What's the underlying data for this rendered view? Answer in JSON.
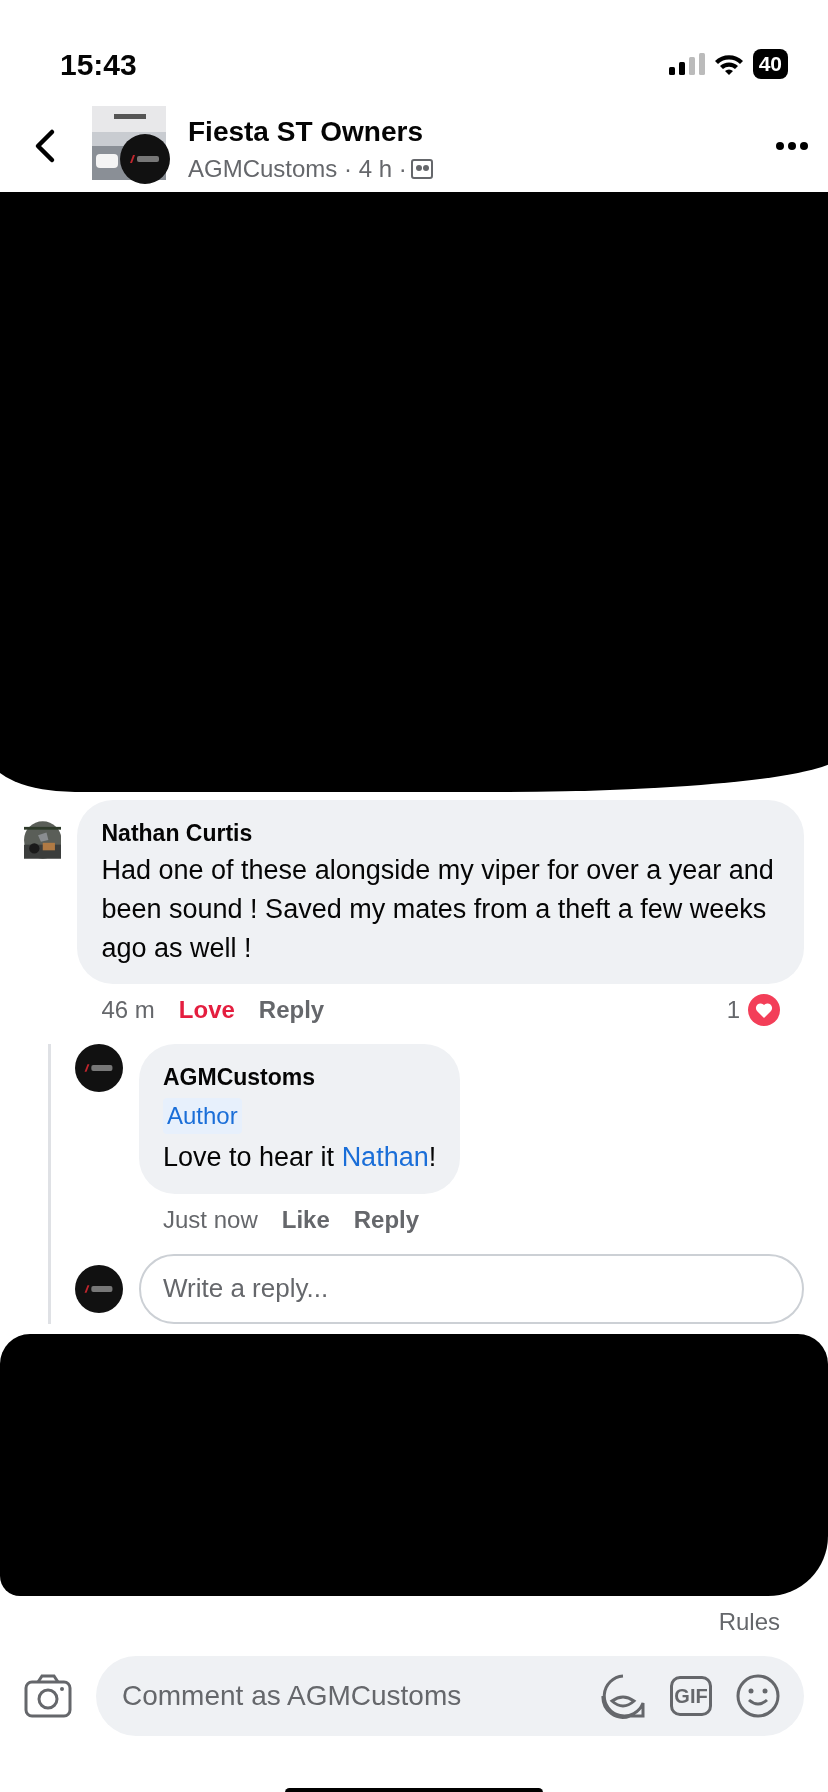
{
  "status_bar": {
    "time": "15:43",
    "battery": "40"
  },
  "header": {
    "title": "Fiesta ST Owners",
    "subtitle": "AGMCustoms · 4 h ·"
  },
  "redactions": [
    {
      "kind": "redacted"
    },
    {
      "kind": "redacted"
    }
  ],
  "comment": {
    "author": "Nathan Curtis",
    "text": "Had one of these alongside my viper for over a year and been sound ! Saved my mates from a theft a few weeks ago as well !",
    "time": "46 m",
    "reaction_button": {
      "label": "Love",
      "selected": true
    },
    "reply_button": "Reply",
    "reaction_count": "1",
    "replies": [
      {
        "author": "AGMCustoms",
        "badge": "Author",
        "text": "Love to hear it ",
        "mention": "Nathan",
        "after": "!",
        "time": "Just now",
        "reaction_button": {
          "label": "Like",
          "selected": false
        },
        "reply_button": "Reply"
      }
    ],
    "reply_field": {
      "placeholder": "Write a reply..."
    }
  },
  "rules_link": "Rules",
  "composer": {
    "placeholder": "Comment as AGMCustoms",
    "gif_button": "GIF"
  }
}
